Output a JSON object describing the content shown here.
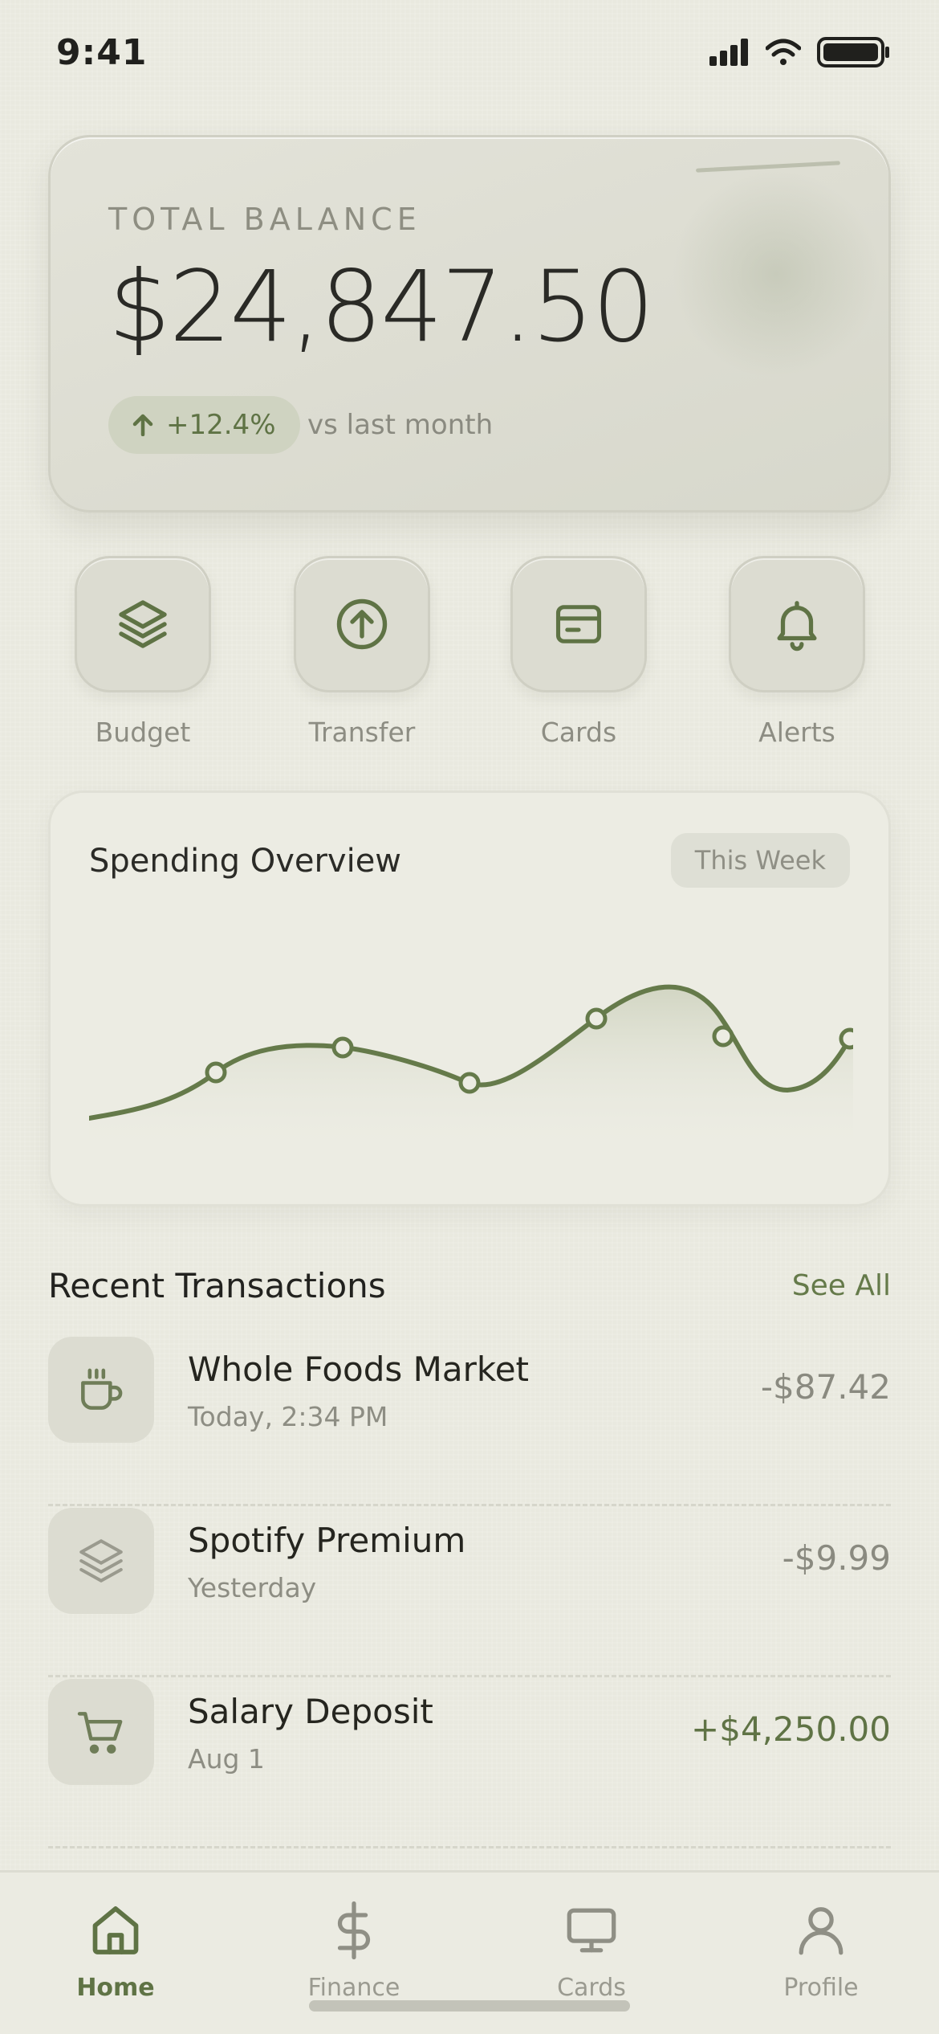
{
  "status_bar": {
    "time": "9:41",
    "icons": [
      "signal-icon",
      "wifi-icon",
      "battery-icon"
    ]
  },
  "balance": {
    "label": "TOTAL BALANCE",
    "amount": "$24,847.50",
    "change": "+12.4%",
    "change_note": "vs last month",
    "change_icon": "arrow-up-icon"
  },
  "quick_actions": [
    {
      "label": "Budget",
      "icon": "layers-icon"
    },
    {
      "label": "Transfer",
      "icon": "arrow-up-circle-icon"
    },
    {
      "label": "Cards",
      "icon": "credit-card-icon"
    },
    {
      "label": "Alerts",
      "icon": "bell-icon"
    }
  ],
  "spending": {
    "title": "Spending Overview",
    "period": "This Week"
  },
  "transactions": {
    "title": "Recent Transactions",
    "see_all": "See All",
    "items": [
      {
        "name": "Whole Foods Market",
        "date": "Today, 2:34 PM",
        "amount": "-$87.42",
        "icon": "coffee-cup-icon"
      },
      {
        "name": "Spotify Premium",
        "date": "Yesterday",
        "amount": "-$9.99",
        "icon": "layers-icon"
      },
      {
        "name": "Salary Deposit",
        "date": "Aug 1",
        "amount": "+$4,250.00",
        "icon": "shopping-cart-icon"
      }
    ]
  },
  "tab_bar": {
    "active": "Home",
    "tabs": [
      {
        "label": "Home",
        "icon": "home-icon"
      },
      {
        "label": "Finance",
        "icon": "dollar-icon"
      },
      {
        "label": "Cards",
        "icon": "monitor-icon"
      },
      {
        "label": "Profile",
        "icon": "user-icon"
      }
    ]
  },
  "colors": {
    "accent": "#5f7345",
    "background": "#e9e9df",
    "card": "#dcdcd1",
    "muted_text": "#8d8d83"
  }
}
